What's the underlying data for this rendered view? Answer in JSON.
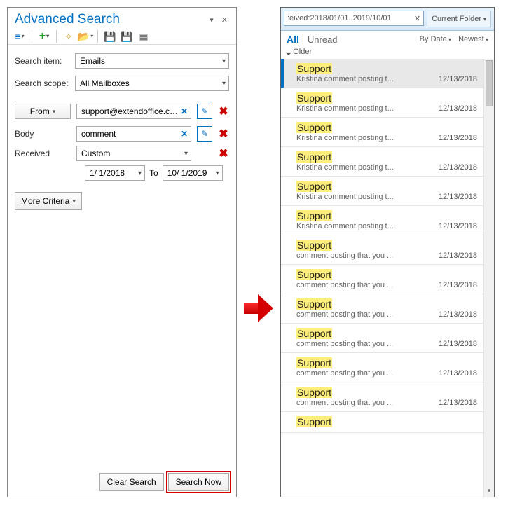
{
  "left": {
    "title": "Advanced Search",
    "searchItemLabel": "Search item:",
    "searchItemValue": "Emails",
    "searchScopeLabel": "Search scope:",
    "searchScopeValue": "All Mailboxes",
    "fromLabel": "From",
    "fromValue": "support@extendoffice.com",
    "bodyLabel": "Body",
    "bodyValue": "comment",
    "receivedLabel": "Received",
    "receivedValue": "Custom",
    "dateFrom": "1/ 1/2018",
    "dateTo": "10/ 1/2019",
    "dateToLabel": "To",
    "moreCriteria": "More Criteria",
    "clearSearch": "Clear Search",
    "searchNow": "Search Now"
  },
  "right": {
    "searchText": ":eived:2018/01/01..2019/10/01",
    "scope": "Current Folder",
    "tabAll": "All",
    "tabUnread": "Unread",
    "sortBy": "By Date",
    "sortDir": "Newest",
    "groupHeader": "Older",
    "items": [
      {
        "sender": "Support",
        "subject": "Kristina comment posting t...",
        "date": "12/13/2018",
        "selected": true
      },
      {
        "sender": "Support",
        "subject": "Kristina comment posting t...",
        "date": "12/13/2018",
        "selected": false
      },
      {
        "sender": "Support",
        "subject": "Kristina comment posting t...",
        "date": "12/13/2018",
        "selected": false
      },
      {
        "sender": "Support",
        "subject": "Kristina comment posting t...",
        "date": "12/13/2018",
        "selected": false
      },
      {
        "sender": "Support",
        "subject": "Kristina comment posting t...",
        "date": "12/13/2018",
        "selected": false
      },
      {
        "sender": "Support",
        "subject": "Kristina comment posting t...",
        "date": "12/13/2018",
        "selected": false
      },
      {
        "sender": "Support",
        "subject": "comment posting that you ...",
        "date": "12/13/2018",
        "selected": false
      },
      {
        "sender": "Support",
        "subject": "comment posting that you ...",
        "date": "12/13/2018",
        "selected": false
      },
      {
        "sender": "Support",
        "subject": "comment posting that you ...",
        "date": "12/13/2018",
        "selected": false
      },
      {
        "sender": "Support",
        "subject": "comment posting that you ...",
        "date": "12/13/2018",
        "selected": false
      },
      {
        "sender": "Support",
        "subject": "comment posting that you ...",
        "date": "12/13/2018",
        "selected": false
      },
      {
        "sender": "Support",
        "subject": "comment posting that you ...",
        "date": "12/13/2018",
        "selected": false
      },
      {
        "sender": "Support",
        "subject": "",
        "date": "",
        "selected": false
      }
    ]
  }
}
